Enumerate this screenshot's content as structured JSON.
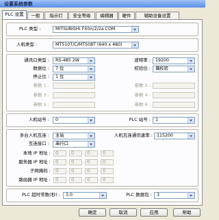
{
  "window": {
    "title": "设置系统参数"
  },
  "tabs": [
    {
      "label": "PLC 设置"
    },
    {
      "label": "一般"
    },
    {
      "label": "指示灯"
    },
    {
      "label": "安全等级"
    },
    {
      "label": "编辑器"
    },
    {
      "label": "硬件"
    },
    {
      "label": "辅助设备设置"
    }
  ],
  "plc": {
    "type_label": "PLC 类型 :",
    "type_value": "MITSUBISHI FX0n/2/2a COM"
  },
  "hmi": {
    "type_label": "人机类型 :",
    "type_value": "MT510T/C/MT508T (640 x 480)"
  },
  "comm": {
    "port_type_label": "通讯口类型 :",
    "port_type_value": "RS-485 2W",
    "baud_label": "波特率 :",
    "baud_value": "19200",
    "databits_label": "数据位 :",
    "databits_value": "7 位",
    "parity_label": "校验位 :",
    "parity_value": "偶校验",
    "stopbits_label": "停止位 :",
    "stopbits_value": "1 位",
    "param1_label": "参数 1 :",
    "param2_label": "参数 2 :",
    "param3_label": "参数 3 :",
    "param4_label": "参数 4 :",
    "param5_label": "参数 5 :",
    "param6_label": "参数 6 :"
  },
  "stations": {
    "hmi_label": "人机站号 :",
    "hmi_value": "0",
    "plc_label": "PLC 站号 :",
    "plc_value": "1"
  },
  "multi": {
    "link_label": "多台人机互连 :",
    "link_value": "主站",
    "speed_label": "人机互连通讯速率 :",
    "speed_value": "115200",
    "port_label": "互连接口 :",
    "port_value": "串行口",
    "local_ip_label": "本地 IP 地址 :",
    "server_ip_label": "服务器 IP 地址 :",
    "subnet_label": "子网掩码 :",
    "router_ip_label": "路由器 IP 地址 :",
    "ip_values": [
      "0",
      "0",
      "0",
      "0"
    ]
  },
  "timing": {
    "timeout_label": "PLC 超时常数(秒) :",
    "timeout_value": "3.0",
    "blocks_label": "PLC 数据包 :",
    "blocks_value": "3"
  },
  "buttons": {
    "ok": "确定",
    "cancel": "取消",
    "apply": "应用",
    "help": "帮助"
  },
  "colors": {
    "titlebar": "#5b8ee6",
    "dialog_bg": "#ece9d8",
    "panel_bg": "#fcfcfe"
  }
}
